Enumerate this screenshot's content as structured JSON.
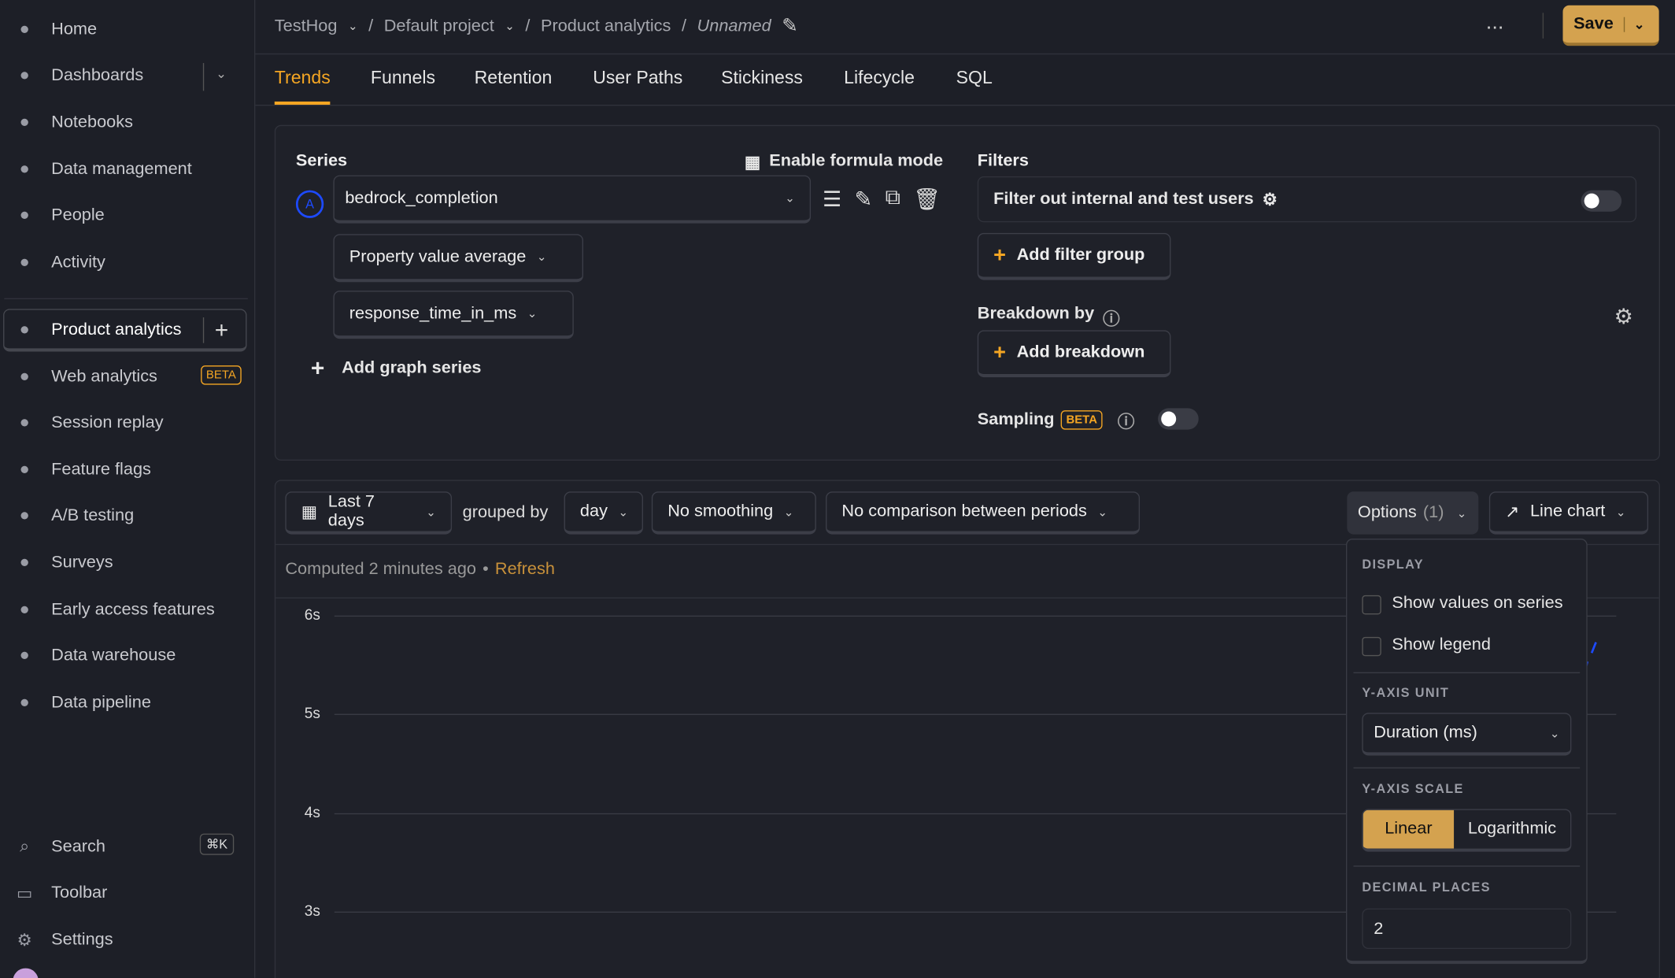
{
  "sidebar": {
    "items": [
      {
        "label": "Home",
        "icon": "home-icon"
      },
      {
        "label": "Dashboards",
        "icon": "dashboard-icon"
      },
      {
        "label": "Notebooks",
        "icon": "notebook-icon"
      },
      {
        "label": "Data management",
        "icon": "database-icon"
      },
      {
        "label": "People",
        "icon": "people-icon"
      },
      {
        "label": "Activity",
        "icon": "activity-icon"
      },
      {
        "label": "Product analytics",
        "icon": "bar-chart-icon"
      },
      {
        "label": "Web analytics",
        "icon": "pie-chart-icon",
        "badge": "BETA"
      },
      {
        "label": "Session replay",
        "icon": "replay-icon"
      },
      {
        "label": "Feature flags",
        "icon": "toggle-icon"
      },
      {
        "label": "A/B testing",
        "icon": "flask-icon"
      },
      {
        "label": "Surveys",
        "icon": "survey-icon"
      },
      {
        "label": "Early access features",
        "icon": "rocket-icon"
      },
      {
        "label": "Data warehouse",
        "icon": "warehouse-icon"
      },
      {
        "label": "Data pipeline",
        "icon": "pipeline-icon"
      }
    ],
    "bottom": [
      {
        "label": "Search",
        "shortcut": "⌘K"
      },
      {
        "label": "Toolbar"
      },
      {
        "label": "Settings"
      }
    ]
  },
  "breadcrumb": {
    "org": "TestHog",
    "project": "Default project",
    "section": "Product analytics",
    "name": "Unnamed"
  },
  "header": {
    "save": "Save",
    "more": "..."
  },
  "tabs": [
    "Trends",
    "Funnels",
    "Retention",
    "User Paths",
    "Stickiness",
    "Lifecycle",
    "SQL"
  ],
  "series": {
    "title": "Series",
    "formula": "Enable formula mode",
    "letter": "A",
    "event": "bedrock_completion",
    "aggregation": "Property value average",
    "property": "response_time_in_ms",
    "add": "Add graph series"
  },
  "filters": {
    "title": "Filters",
    "internal": "Filter out internal and test users",
    "internal_on": false,
    "add_group": "Add filter group",
    "breakdown_title": "Breakdown by",
    "add_breakdown": "Add breakdown",
    "sampling": "Sampling",
    "sampling_badge": "BETA",
    "sampling_on": false
  },
  "toolbar": {
    "date": "Last 7 days",
    "grouped_by": "grouped by",
    "interval": "day",
    "smoothing": "No smoothing",
    "compare": "No comparison between periods",
    "options": "Options",
    "options_count": "(1)",
    "chart_type": "Line chart"
  },
  "status": {
    "computed": "Computed 2 minutes ago",
    "sep": "•",
    "refresh": "Refresh"
  },
  "options_popup": {
    "display": "DISPLAY",
    "show_values": "Show values on series",
    "show_legend": "Show legend",
    "yunit_title": "Y-AXIS UNIT",
    "yunit": "Duration (ms)",
    "yscale_title": "Y-AXIS SCALE",
    "linear": "Linear",
    "log": "Logarithmic",
    "scale_selected": "Linear",
    "decimal_title": "DECIMAL PLACES",
    "decimal": "2"
  },
  "colors": {
    "accent": "#f5a623",
    "series": "#1d4aff",
    "active_btn": "#d4a24f"
  },
  "chart_data": {
    "type": "line",
    "yticks": [
      "6s",
      "5s",
      "4s",
      "3s"
    ],
    "grid": true,
    "series": [
      {
        "color": "#1d4aff"
      }
    ]
  }
}
